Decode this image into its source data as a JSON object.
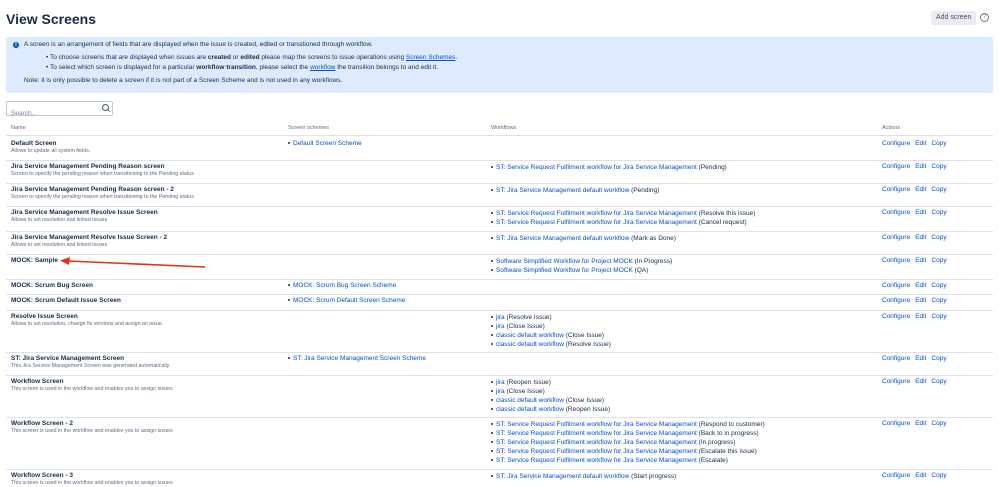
{
  "header": {
    "title": "View Screens",
    "add_button": "Add screen",
    "help": "?"
  },
  "info": {
    "line1": "A screen is an arrangement of fields that are displayed when the issue is created, edited or transitioned through workflow.",
    "b1_pre": "To choose screens that are displayed when issues are ",
    "b1_created": "created",
    "b1_or": " or ",
    "b1_edited": "edited",
    "b1_mid": " please map the screens to issue operations using ",
    "b1_link": "Screen Schemes",
    "b1_end": ".",
    "b2_pre": "To select which screen is displayed for a particular ",
    "b2_bold": "workflow transition",
    "b2_mid": ", please select the ",
    "b2_link": "workflow",
    "b2_end": " the transition belongs to and edit it.",
    "note": "Note: it is only possible to delete a screen if it is not part of a Screen Scheme and is not used in any workflows."
  },
  "search": {
    "placeholder": "Search..."
  },
  "columns": {
    "name": "Name",
    "schemes": "Screen schemes",
    "workflows": "Workflows",
    "actions": "Actions"
  },
  "actions": {
    "configure": "Configure",
    "edit": "Edit",
    "copy": "Copy"
  },
  "rows": [
    {
      "name": "Default Screen",
      "desc": "Allows to update all system fields.",
      "scheme": "Default Screen Scheme",
      "workflows": []
    },
    {
      "name": "Jira Service Management Pending Reason screen",
      "desc": "Screen to specify the pending reason when transitioning to the Pending status",
      "scheme": "",
      "workflows": [
        {
          "link": "ST: Service Request Fulfilment workflow for Jira Service Management",
          "note": " (Pending)"
        }
      ]
    },
    {
      "name": "Jira Service Management Pending Reason screen - 2",
      "desc": "Screen to specify the pending reason when transitioning to the Pending status",
      "scheme": "",
      "workflows": [
        {
          "link": "ST: Jira Service Management default workflow",
          "note": " (Pending)"
        }
      ]
    },
    {
      "name": "Jira Service Management Resolve Issue Screen",
      "desc": "Allows to set resolution and linked issues",
      "scheme": "",
      "workflows": [
        {
          "link": "ST: Service Request Fulfilment workflow for Jira Service Management",
          "note": " (Resolve this issue)"
        },
        {
          "link": "ST: Service Request Fulfilment workflow for Jira Service Management",
          "note": " (Cancel request)"
        }
      ]
    },
    {
      "name": "Jira Service Management Resolve Issue Screen - 2",
      "desc": "Allows to set resolution and linked issues",
      "scheme": "",
      "workflows": [
        {
          "link": "ST: Jira Service Management default workflow",
          "note": " (Mark as Done)"
        }
      ]
    },
    {
      "name": "MOCK: Sample",
      "desc": "",
      "scheme": "",
      "workflows": [
        {
          "link": "Software Simplified Workflow for Project MOCK",
          "note": " (In Progress)"
        },
        {
          "link": "Software Simplified Workflow for Project MOCK",
          "note": " (QA)"
        }
      ]
    },
    {
      "name": "MOCK: Scrum Bug Screen",
      "desc": "",
      "scheme": "MOCK: Scrum Bug Screen Scheme",
      "workflows": []
    },
    {
      "name": "MOCK: Scrum Default Issue Screen",
      "desc": "",
      "scheme": "MOCK: Scrum Default Screen Scheme",
      "workflows": []
    },
    {
      "name": "Resolve Issue Screen",
      "desc": "Allows to set resolution, change fix versions and assign an issue.",
      "scheme": "",
      "workflows": [
        {
          "link": "jira",
          "note": " (Resolve Issue)"
        },
        {
          "link": "jira",
          "note": " (Close Issue)"
        },
        {
          "link": "classic default workflow",
          "note": " (Close Issue)"
        },
        {
          "link": "classic default workflow",
          "note": " (Resolve Issue)"
        }
      ]
    },
    {
      "name": "ST: Jira Service Management Screen",
      "desc": "This Jira Service Management Screen was generated automatically",
      "scheme": "ST: Jira Service Management Screen Scheme",
      "workflows": []
    },
    {
      "name": "Workflow Screen",
      "desc": "This screen is used in the workflow and enables you to assign issues",
      "scheme": "",
      "workflows": [
        {
          "link": "jira",
          "note": " (Reopen Issue)"
        },
        {
          "link": "jira",
          "note": " (Close Issue)"
        },
        {
          "link": "classic default workflow",
          "note": " (Close Issue)"
        },
        {
          "link": "classic default workflow",
          "note": " (Reopen Issue)"
        }
      ]
    },
    {
      "name": "Workflow Screen - 2",
      "desc": "This screen is used in the workflow and enables you to assign issues",
      "scheme": "",
      "workflows": [
        {
          "link": "ST: Service Request Fulfilment workflow for Jira Service Management",
          "note": " (Respond to customer)"
        },
        {
          "link": "ST: Service Request Fulfilment workflow for Jira Service Management",
          "note": " (Back to in progress)"
        },
        {
          "link": "ST: Service Request Fulfilment workflow for Jira Service Management",
          "note": " (In progress)"
        },
        {
          "link": "ST: Service Request Fulfilment workflow for Jira Service Management",
          "note": " (Escalate this issue)"
        },
        {
          "link": "ST: Service Request Fulfilment workflow for Jira Service Management",
          "note": " (Escalate)"
        }
      ]
    },
    {
      "name": "Workflow Screen - 3",
      "desc": "This screen is used in the workflow and enables you to assign issues",
      "scheme": "",
      "workflows": [
        {
          "link": "ST: Jira Service Management default workflow",
          "note": " (Start progress)"
        }
      ]
    }
  ],
  "colors": {
    "link": "#0052cc",
    "info_bg": "#deebff",
    "arrow": "#de350b"
  }
}
